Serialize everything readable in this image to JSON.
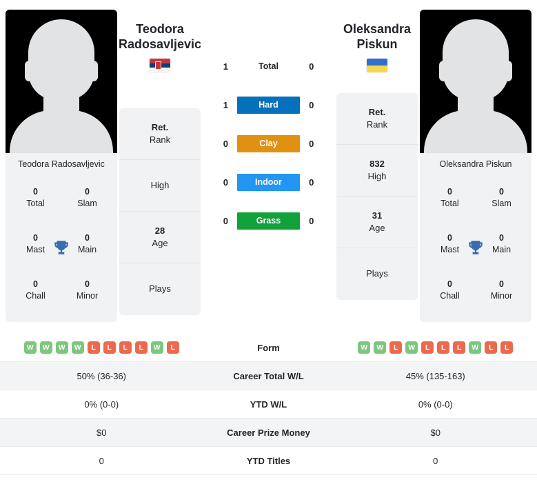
{
  "players": {
    "left": {
      "first_name": "Teodora",
      "last_name": "Radosavljevic",
      "full_name": "Teodora Radosavljevic",
      "country_flag": "serbia-flag",
      "photo_caption": "Teodora Radosavljevic",
      "rank": {
        "value": "Ret.",
        "label": "Rank"
      },
      "high": {
        "value": "",
        "label": "High"
      },
      "age": {
        "value": "28",
        "label": "Age"
      },
      "plays": {
        "value": "",
        "label": "Plays"
      },
      "titles": [
        {
          "num": "0",
          "label": "Total"
        },
        {
          "num": "0",
          "label": "Slam"
        },
        {
          "num": "0",
          "label": "Mast"
        },
        {
          "num": "0",
          "label": "Main"
        },
        {
          "num": "0",
          "label": "Chall"
        },
        {
          "num": "0",
          "label": "Minor"
        }
      ],
      "form": [
        "W",
        "W",
        "W",
        "W",
        "L",
        "L",
        "L",
        "L",
        "W",
        "L"
      ]
    },
    "right": {
      "first_name": "Oleksandra",
      "last_name": "Piskun",
      "full_name": "Oleksandra Piskun",
      "country_flag": "ukraine-flag",
      "photo_caption": "Oleksandra Piskun",
      "rank": {
        "value": "Ret.",
        "label": "Rank"
      },
      "high": {
        "value": "832",
        "label": "High"
      },
      "age": {
        "value": "31",
        "label": "Age"
      },
      "plays": {
        "value": "",
        "label": "Plays"
      },
      "titles": [
        {
          "num": "0",
          "label": "Total"
        },
        {
          "num": "0",
          "label": "Slam"
        },
        {
          "num": "0",
          "label": "Mast"
        },
        {
          "num": "0",
          "label": "Main"
        },
        {
          "num": "0",
          "label": "Chall"
        },
        {
          "num": "0",
          "label": "Minor"
        }
      ],
      "form": [
        "W",
        "W",
        "L",
        "W",
        "L",
        "L",
        "L",
        "W",
        "L",
        "L"
      ]
    }
  },
  "surfaces": [
    {
      "label": "Total",
      "left": "1",
      "right": "0",
      "color": "transparent",
      "is_total": true
    },
    {
      "label": "Hard",
      "left": "1",
      "right": "0",
      "color": "#0770BA",
      "is_total": false
    },
    {
      "label": "Clay",
      "left": "0",
      "right": "0",
      "color": "#E09112",
      "is_total": false
    },
    {
      "label": "Indoor",
      "left": "0",
      "right": "0",
      "color": "#2196F3",
      "is_total": false
    },
    {
      "label": "Grass",
      "left": "0",
      "right": "0",
      "color": "#13A13A",
      "is_total": false
    }
  ],
  "stats_rows": [
    {
      "label": "Form",
      "left": "",
      "right": "",
      "type": "form"
    },
    {
      "label": "Career Total W/L",
      "left": "50% (36-36)",
      "right": "45% (135-163)",
      "type": "text"
    },
    {
      "label": "YTD W/L",
      "left": "0% (0-0)",
      "right": "0% (0-0)",
      "type": "text"
    },
    {
      "label": "Career Prize Money",
      "left": "$0",
      "right": "$0",
      "type": "text"
    },
    {
      "label": "YTD Titles",
      "left": "0",
      "right": "0",
      "type": "text"
    }
  ],
  "colors": {
    "win_badge": "#7DC67F",
    "loss_badge": "#EB6A4D",
    "trophy": "#3A6BB0",
    "card_bg": "#f1f2f3"
  }
}
